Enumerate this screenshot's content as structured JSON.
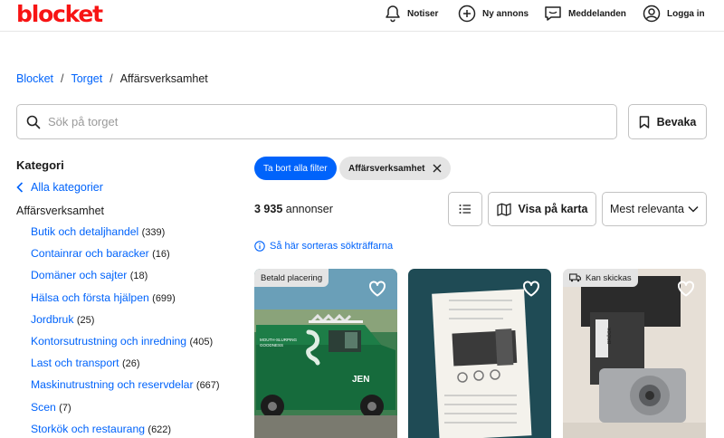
{
  "header": {
    "logo": "blocket",
    "nav": [
      {
        "label": "Notiser",
        "icon": "bell-icon"
      },
      {
        "label": "Ny annons",
        "icon": "plus-circle-icon"
      },
      {
        "label": "Meddelanden",
        "icon": "message-icon"
      },
      {
        "label": "Logga in",
        "icon": "user-icon"
      }
    ]
  },
  "breadcrumb": [
    {
      "label": "Blocket",
      "link": true
    },
    {
      "label": "Torget",
      "link": true
    },
    {
      "label": "Affärsverksamhet",
      "link": false
    }
  ],
  "search": {
    "placeholder": "Sök på torget",
    "value": "",
    "save_label": "Bevaka"
  },
  "sidebar": {
    "heading": "Kategori",
    "all_label": "Alla kategorier",
    "current": "Affärsverksamhet",
    "subcategories": [
      {
        "label": "Butik och detaljhandel",
        "count": "(339)"
      },
      {
        "label": "Containrar och baracker",
        "count": "(16)"
      },
      {
        "label": "Domäner och sajter",
        "count": "(18)"
      },
      {
        "label": "Hälsa och första hjälpen",
        "count": "(699)"
      },
      {
        "label": "Jordbruk",
        "count": "(25)"
      },
      {
        "label": "Kontorsutrustning och inredning",
        "count": "(405)"
      },
      {
        "label": "Last och transport",
        "count": "(26)"
      },
      {
        "label": "Maskinutrustning och reservdelar",
        "count": "(667)"
      },
      {
        "label": "Scen",
        "count": "(7)"
      },
      {
        "label": "Storkök och restaurang",
        "count": "(622)"
      }
    ]
  },
  "filters": {
    "clear_label": "Ta bort alla filter",
    "active": "Affärsverksamhet"
  },
  "results": {
    "count": "3 935",
    "count_suffix": "annonser",
    "map_label": "Visa på karta",
    "sort_value": "Mest relevanta",
    "sort_info": "Så här sorteras sökträffarna"
  },
  "cards": [
    {
      "badge": "Betald placering",
      "image": "green food truck"
    },
    {
      "badge": "",
      "image": "rotary hammer drill box"
    },
    {
      "badge": "Kan skickas",
      "image": "electric gear motor"
    }
  ],
  "colors": {
    "brand": "#f71414",
    "link": "#0063fb",
    "chip": "#e4e4e4"
  }
}
